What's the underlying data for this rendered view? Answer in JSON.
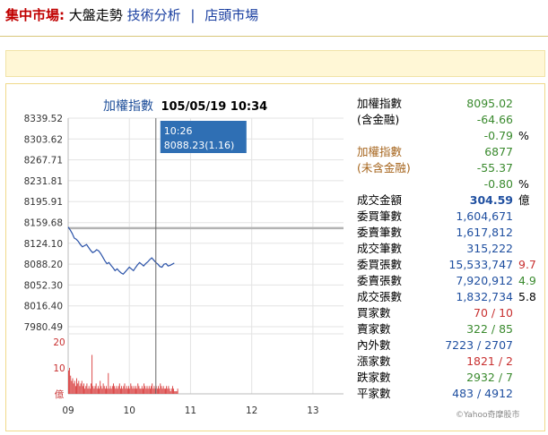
{
  "nav": {
    "market": "集中市場:",
    "current": "大盤走勢",
    "link1": "技術分析",
    "sep": "|",
    "link2": "店頭市場"
  },
  "chart": {
    "title": "加權指數",
    "datetime": "105/05/19 10:34"
  },
  "tooltip": {
    "time": "10:26",
    "value": "8088.23(1.16)"
  },
  "chart_data": {
    "type": "line",
    "title": "加權指數",
    "y_ticks": [
      "8339.52",
      "8303.62",
      "8267.71",
      "8231.81",
      "8195.91",
      "8159.68",
      "8124.10",
      "8088.20",
      "8052.30",
      "8016.40",
      "7980.49"
    ],
    "ylim": [
      7980.49,
      8339.52
    ],
    "reference_line": 8150.09,
    "x_ticks": [
      "09",
      "10",
      "11",
      "12",
      "13"
    ],
    "volume_ticks": [
      "20",
      "10",
      "億"
    ],
    "series": [
      {
        "values": [
          8152,
          8147,
          8141,
          8133,
          8131,
          8127,
          8122,
          8118,
          8120,
          8122,
          8117,
          8112,
          8108,
          8110,
          8113,
          8111,
          8106,
          8100,
          8094,
          8089,
          8091,
          8086,
          8082,
          8077,
          8080,
          8076,
          8073,
          8071,
          8075,
          8079,
          8083,
          8080,
          8077,
          8082,
          8087,
          8091,
          8088,
          8085,
          8089,
          8092,
          8096,
          8099,
          8095,
          8091,
          8088,
          8084,
          8083,
          8088,
          8089,
          8085,
          8086,
          8088,
          8090
        ]
      }
    ],
    "volume": [
      9,
      10,
      7,
      5,
      6,
      4,
      5,
      3,
      6,
      4,
      5,
      3,
      4,
      5,
      3,
      4,
      2,
      3,
      4,
      2,
      3,
      2,
      4,
      15,
      3,
      2,
      3,
      4,
      2,
      3,
      2,
      5,
      3,
      2,
      4,
      3,
      2,
      3,
      2,
      8,
      2,
      3,
      2,
      3,
      4,
      3,
      2,
      3,
      2,
      3,
      4,
      2,
      3,
      2,
      3,
      4,
      2,
      3,
      2,
      3,
      2,
      4,
      3,
      2,
      3,
      2,
      3,
      2,
      4,
      3,
      2,
      2,
      3,
      2,
      4,
      3,
      2,
      3,
      2,
      3,
      2,
      3,
      4,
      2,
      3,
      2,
      3,
      2,
      3,
      2,
      4,
      3,
      2,
      3,
      2,
      2,
      3,
      2,
      3,
      2,
      1,
      2,
      3,
      2,
      1,
      1,
      1,
      2
    ]
  },
  "stats": [
    {
      "label": "加權指數",
      "value": "8095.02",
      "ext": "",
      "lc": "k",
      "vc": "g",
      "ec": "k",
      "bold": false
    },
    {
      "label": "(含金融)",
      "value": "-64.66",
      "ext": "",
      "lc": "k",
      "vc": "g",
      "ec": "k",
      "bold": false
    },
    {
      "label": "",
      "value": "-0.79",
      "ext": "%",
      "lc": "k",
      "vc": "g",
      "ec": "k",
      "bold": false
    },
    {
      "label": "加權指數",
      "value": "6877",
      "ext": "",
      "lc": "o",
      "vc": "g",
      "ec": "k",
      "bold": false
    },
    {
      "label": "(未含金融)",
      "value": "-55.37",
      "ext": "",
      "lc": "o",
      "vc": "g",
      "ec": "k",
      "bold": false
    },
    {
      "label": "",
      "value": "-0.80",
      "ext": "%",
      "lc": "k",
      "vc": "g",
      "ec": "k",
      "bold": false
    },
    {
      "label": "成交金額",
      "value": "304.59",
      "ext": "億",
      "lc": "k",
      "vc": "bluev",
      "ec": "k",
      "bold": true
    },
    {
      "label": "委買筆數",
      "value": "1,604,671",
      "ext": "",
      "lc": "k",
      "vc": "bluev",
      "ec": "k",
      "bold": false
    },
    {
      "label": "委賣筆數",
      "value": "1,617,812",
      "ext": "",
      "lc": "k",
      "vc": "bluev",
      "ec": "k",
      "bold": false
    },
    {
      "label": "成交筆數",
      "value": "315,222",
      "ext": "",
      "lc": "k",
      "vc": "bluev",
      "ec": "k",
      "bold": false
    },
    {
      "label": "委買張數",
      "value": "15,533,747",
      "ext": "9.7",
      "lc": "k",
      "vc": "bluev",
      "ec": "r",
      "bold": false
    },
    {
      "label": "委賣張數",
      "value": "7,920,912",
      "ext": "4.9",
      "lc": "k",
      "vc": "bluev",
      "ec": "g",
      "bold": false
    },
    {
      "label": "成交張數",
      "value": "1,832,734",
      "ext": "5.8",
      "lc": "k",
      "vc": "bluev",
      "ec": "k",
      "bold": false
    },
    {
      "label": "買家數",
      "value": "70 / 10",
      "ext": "",
      "lc": "k",
      "vc": "r",
      "ec": "k",
      "bold": false
    },
    {
      "label": "賣家數",
      "value": "322 / 85",
      "ext": "",
      "lc": "k",
      "vc": "g",
      "ec": "k",
      "bold": false
    },
    {
      "label": "內外數",
      "value": "7223 / 2707",
      "ext": "",
      "lc": "k",
      "vc": "bluev",
      "ec": "k",
      "bold": false
    },
    {
      "label": "漲家數",
      "value": "1821 / 2",
      "ext": "",
      "lc": "k",
      "vc": "r",
      "ec": "k",
      "bold": false
    },
    {
      "label": "跌家數",
      "value": "2932 / 7",
      "ext": "",
      "lc": "k",
      "vc": "g",
      "ec": "k",
      "bold": false
    },
    {
      "label": "平家數",
      "value": "483 / 4912",
      "ext": "",
      "lc": "k",
      "vc": "bluev",
      "ec": "k",
      "bold": false
    }
  ],
  "footer": "©Yahoo奇摩股市",
  "colors": {
    "accent": "#1f4f9a",
    "up": "#c83030",
    "down": "#3a8a2e",
    "tooltip_bg": "#2f6fb4"
  }
}
